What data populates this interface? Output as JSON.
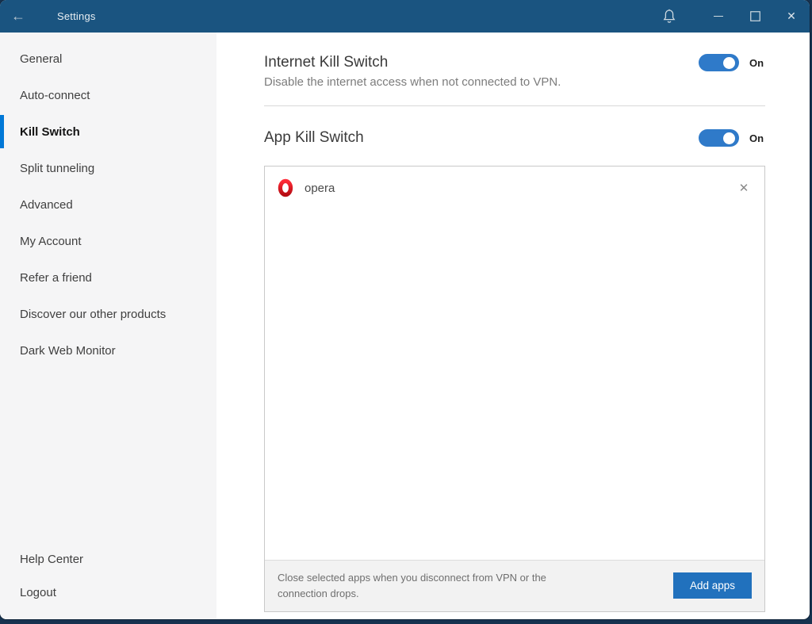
{
  "titlebar": {
    "title": "Settings",
    "icons": {
      "back": "←",
      "bell": "bell-outline",
      "minimize": "minimize-line",
      "maximize": "maximize-square",
      "close": "✕"
    }
  },
  "sidebar": {
    "selected": "Kill Switch",
    "items": [
      {
        "label": "General"
      },
      {
        "label": "Auto-connect"
      },
      {
        "label": "Kill Switch"
      },
      {
        "label": "Split tunneling"
      },
      {
        "label": "Advanced"
      },
      {
        "label": "My Account"
      },
      {
        "label": "Refer a friend"
      },
      {
        "label": "Discover our other products"
      },
      {
        "label": "Dark Web Monitor"
      }
    ],
    "footer_items": [
      {
        "label": "Help Center"
      },
      {
        "label": "Logout"
      }
    ]
  },
  "sections": {
    "internet_kill_switch": {
      "title": "Internet Kill Switch",
      "description": "Disable the internet access when not connected to VPN.",
      "state": "On"
    },
    "app_kill_switch": {
      "title": "App Kill Switch",
      "state": "On"
    }
  },
  "app_list": {
    "apps": [
      {
        "name": "opera",
        "icon": "opera-icon"
      }
    ],
    "remove_glyph": "✕"
  },
  "panel_footer": {
    "note": "Close selected apps when you disconnect from VPN or the connection drops.",
    "button_label": "Add apps"
  },
  "colors": {
    "titlebar": "#1a5480",
    "accent_toggle": "#2f7ac9",
    "accent_button": "#2171bd",
    "selected_indicator": "#0078d7",
    "opera_red": "#e0121a",
    "sidebar_bg": "#f5f5f6"
  }
}
